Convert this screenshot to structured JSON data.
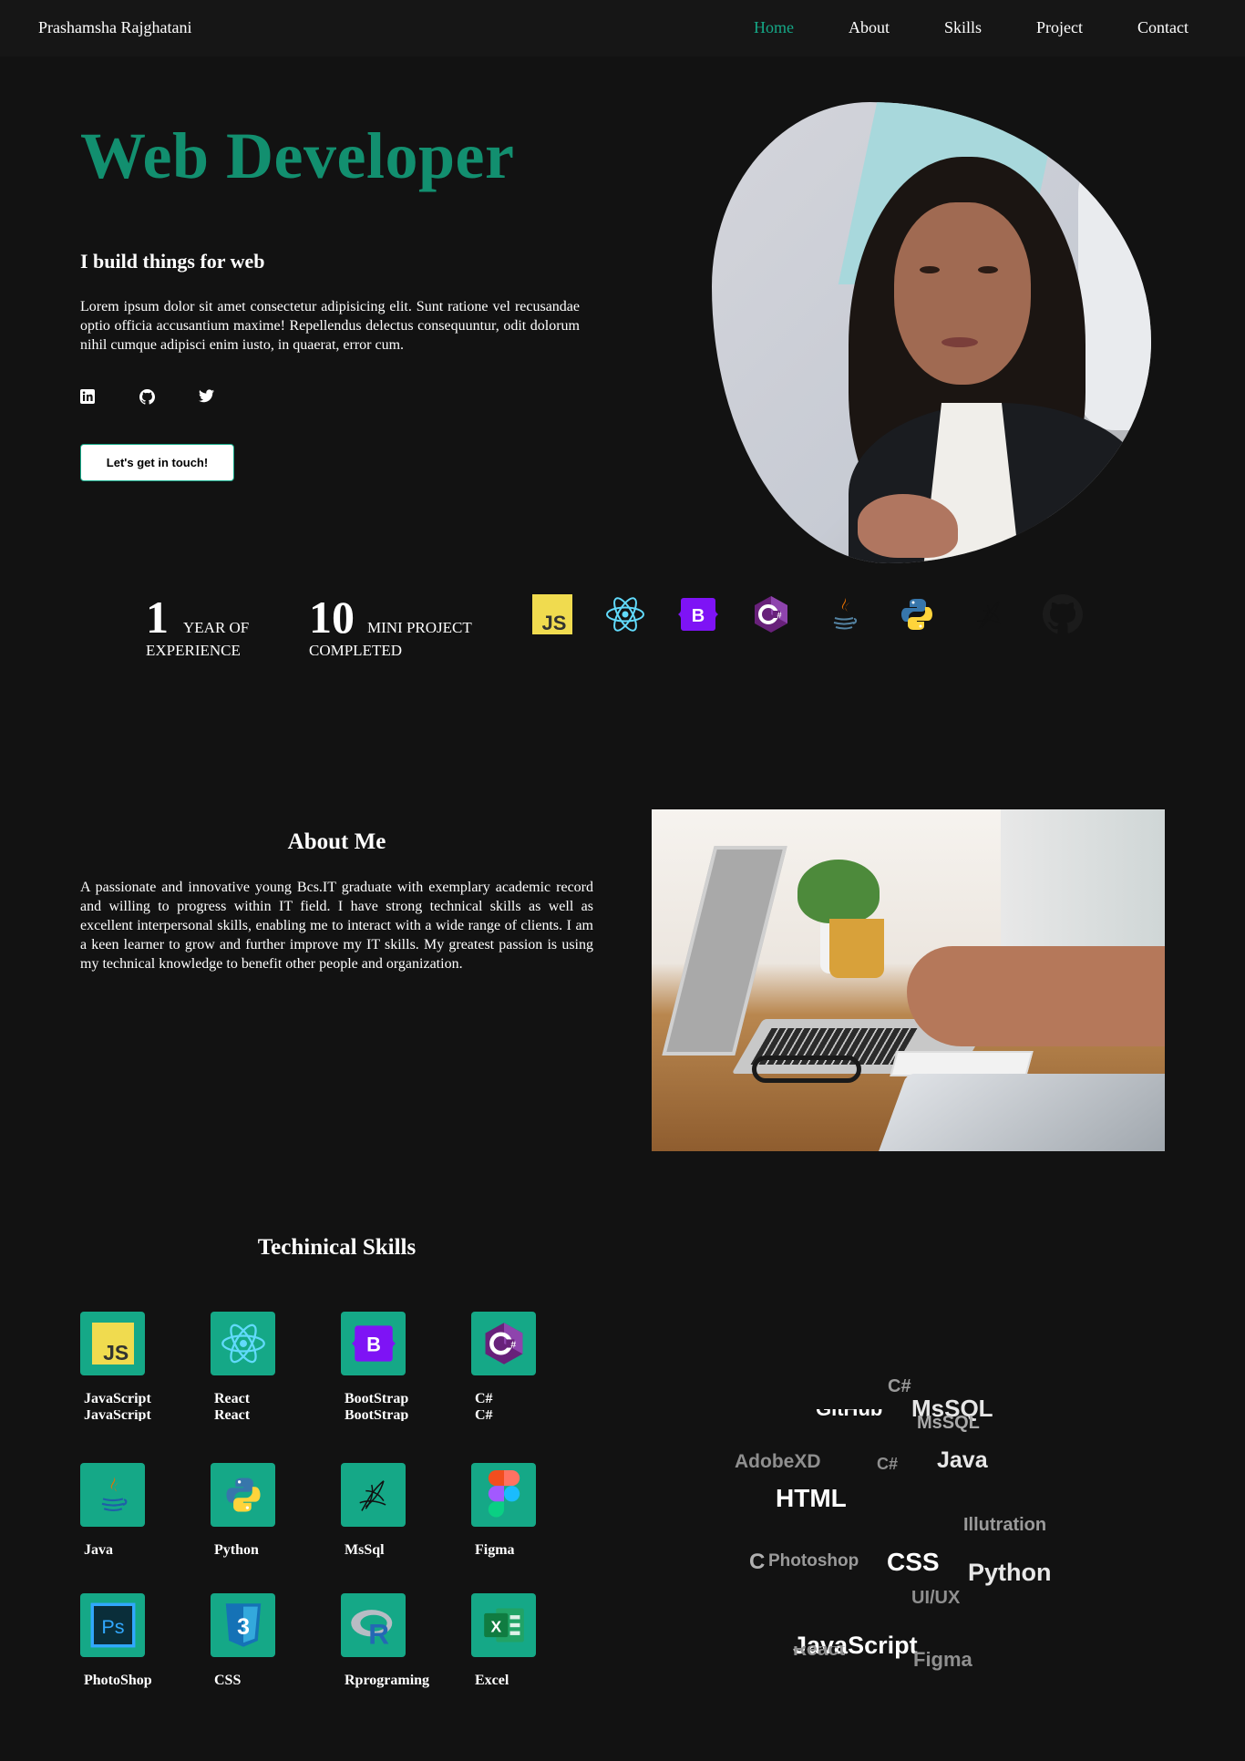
{
  "nav": {
    "brand": "Prashamsha Rajghatani",
    "links": [
      "Home",
      "About",
      "Skills",
      "Project",
      "Contact"
    ]
  },
  "hero": {
    "title": "Web Developer",
    "subtitle": "I build things for web",
    "text": "Lorem ipsum dolor sit amet consectetur adipisicing elit. Sunt ratione vel recusandae optio officia accusantium maxime! Repellendus delectus consequuntur, odit dolorum nihil cumque adipisci enim iusto, in quaerat, error cum.",
    "socials": [
      "linkedin-icon",
      "github-icon",
      "twitter-icon"
    ],
    "cta": "Let's get in touch!"
  },
  "stats": [
    {
      "num": "1",
      "line1": "YEAR OF",
      "line2": "EXPERIENCE"
    },
    {
      "num": "10",
      "line1": "MINI PROJECT",
      "line2": "COMPLETED"
    }
  ],
  "tech_icons": [
    "javascript-icon",
    "react-icon",
    "bootstrap-icon",
    "csharp-icon",
    "java-icon",
    "python-icon",
    "mssql-icon",
    "github-icon"
  ],
  "about": {
    "title": "About Me",
    "text": "A passionate and innovative young Bcs.IT graduate with exemplary academic record and willing to progress within IT field. I have strong technical skills as well as excellent interpersonal skills, enabling me to interact with a wide range of clients. I am a keen learner to grow and further improve my IT skills. My greatest passion is using my technical knowledge to benefit other people and organization."
  },
  "skills": {
    "title": "Techinical Skills",
    "items": [
      "JavaScript",
      "React",
      "BootStrap",
      "C#",
      "Java",
      "Python",
      "MsSql",
      "Figma",
      "PhotoShop",
      "CSS",
      "Rprograming",
      "Excel"
    ],
    "ghost_labels": [
      "JavaScript",
      "React",
      "BootStrap",
      "C#"
    ]
  },
  "cloud": {
    "words": [
      "C#",
      "MsSQL",
      "MsSQL",
      "GitHub",
      "AdobeXD",
      "C#",
      "Java",
      "HTML",
      "Illutration",
      "C",
      "Photoshop",
      "CSS",
      "Python",
      "UI/UX",
      "JavaScript",
      "React",
      "Figma"
    ]
  },
  "colors": {
    "accent": "#15a887",
    "title": "#128f6f",
    "background": "#121212"
  }
}
